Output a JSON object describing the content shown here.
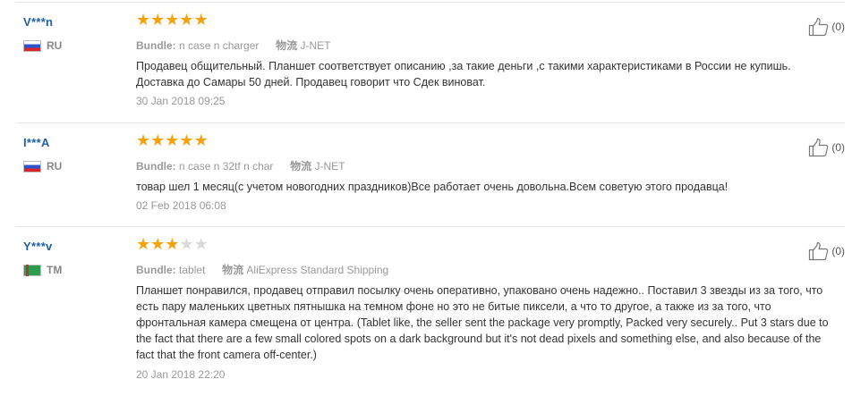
{
  "reviews": [
    {
      "user": "V***n",
      "country": "RU",
      "rating": 5,
      "bundle_label": "Bundle:",
      "bundle_value": "n case n charger",
      "shipping_label": "物流",
      "shipping_value": "J-NET",
      "text": "Продавец общительный. Планшет соответствует описанию ,за такие деньги ,с такими характеристиками в России не купишь. Доставка до Самары 50 дней. Продавец говорит что Сдек виноват.",
      "date": "30 Jan 2018 09:25",
      "helpful_count": "(0)"
    },
    {
      "user": "I***A",
      "country": "RU",
      "rating": 5,
      "bundle_label": "Bundle:",
      "bundle_value": "n case n 32tf n char",
      "shipping_label": "物流",
      "shipping_value": "J-NET",
      "text": "товар шел 1 месяц(с учетом новогодних праздников)Все работает очень довольна.Всем советую этого продавца!",
      "date": "02 Feb 2018 06:08",
      "helpful_count": "(0)"
    },
    {
      "user": "Y***v",
      "country": "TM",
      "rating": 3,
      "bundle_label": "Bundle:",
      "bundle_value": "tablet",
      "shipping_label": "物流",
      "shipping_value": "AliExpress Standard Shipping",
      "text": "Планшет понравился, продавец отправил посылку очень оперативно, упаковано очень надежно.. Поставил 3 звезды из за того, что есть пару маленьких цветных пятнышка на темном фоне но это не битые пиксели, а что то другое, а также из за того, что фронтальная камера смещена от центра. (Tablet like, the seller sent the package very promptly, Packed very securely.. Put 3 stars due to the fact that there are a few small colored spots on a dark background but it's not dead pixels and something else, and also because of the fact that the front camera off-center.)",
      "date": "20 Jan 2018 22:20",
      "helpful_count": "(0)"
    }
  ],
  "colors": {
    "star_on": "#f5a20a",
    "star_off": "#d9d9d9",
    "username": "#1f5fa8"
  },
  "icons": {
    "helpful": "thumbs-up-icon",
    "rating": "star-icon"
  }
}
